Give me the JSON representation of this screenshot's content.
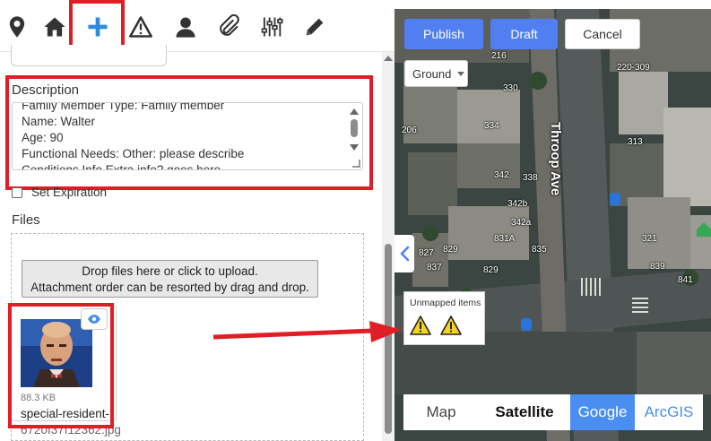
{
  "toolbar": {
    "icons": [
      "location-pin-icon",
      "home-icon",
      "add-icon",
      "warning-icon",
      "user-icon",
      "paperclip-icon",
      "sliders-icon",
      "pencil-icon"
    ],
    "accent": "#2f8be0"
  },
  "description": {
    "label": "Description",
    "lines": [
      "Family Member Type: Family member",
      "Name: Walter",
      "Age: 90",
      "Functional Needs: Other: please describe",
      "Conditions Info Extra info? goes here"
    ]
  },
  "expiration": {
    "label": "Set Expiration"
  },
  "files": {
    "label": "Files",
    "upload_line1": "Drop files here or click to upload.",
    "upload_line2": "Attachment order can be resorted by drag and drop.",
    "attachment": {
      "size": "88.3 KB",
      "name_line1": "special-resident-",
      "name_line2": "6720f37f12362.jpg"
    }
  },
  "map": {
    "buttons": {
      "publish": "Publish",
      "draft": "Draft",
      "cancel": "Cancel"
    },
    "floor_select": "Ground",
    "street": "Throop Ave",
    "building_labels": [
      "216",
      "220-309",
      "330",
      "206",
      "334",
      "313",
      "342",
      "338",
      "342b",
      "342a",
      "827",
      "829",
      "831A",
      "835",
      "321",
      "837",
      "839",
      "829",
      "841"
    ],
    "unmapped": {
      "title": "Unmapped items",
      "count_icons": 2
    },
    "map_types": {
      "map": "Map",
      "satellite": "Satellite",
      "google": "Google",
      "arcgis": "ArcGIS"
    },
    "accent": "#4f7ff0"
  },
  "annotation_color": "#e01e26"
}
